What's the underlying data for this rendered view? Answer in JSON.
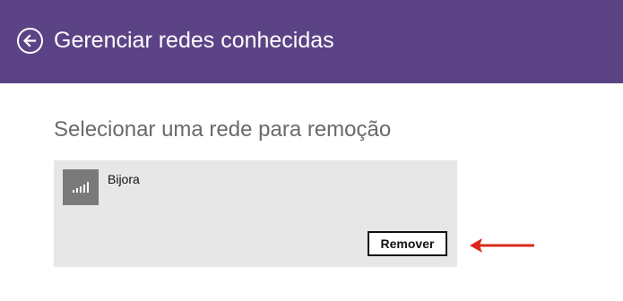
{
  "header": {
    "title": "Gerenciar redes conhecidas",
    "background_color": "#5c4386",
    "back_icon": "back-arrow-circle-icon"
  },
  "main": {
    "section_title": "Selecionar uma rede para remoção",
    "network": {
      "name": "Bijora",
      "icon": "wifi-signal-icon",
      "remove_label": "Remover"
    }
  },
  "annotation": {
    "arrow_color": "#d9291c"
  }
}
